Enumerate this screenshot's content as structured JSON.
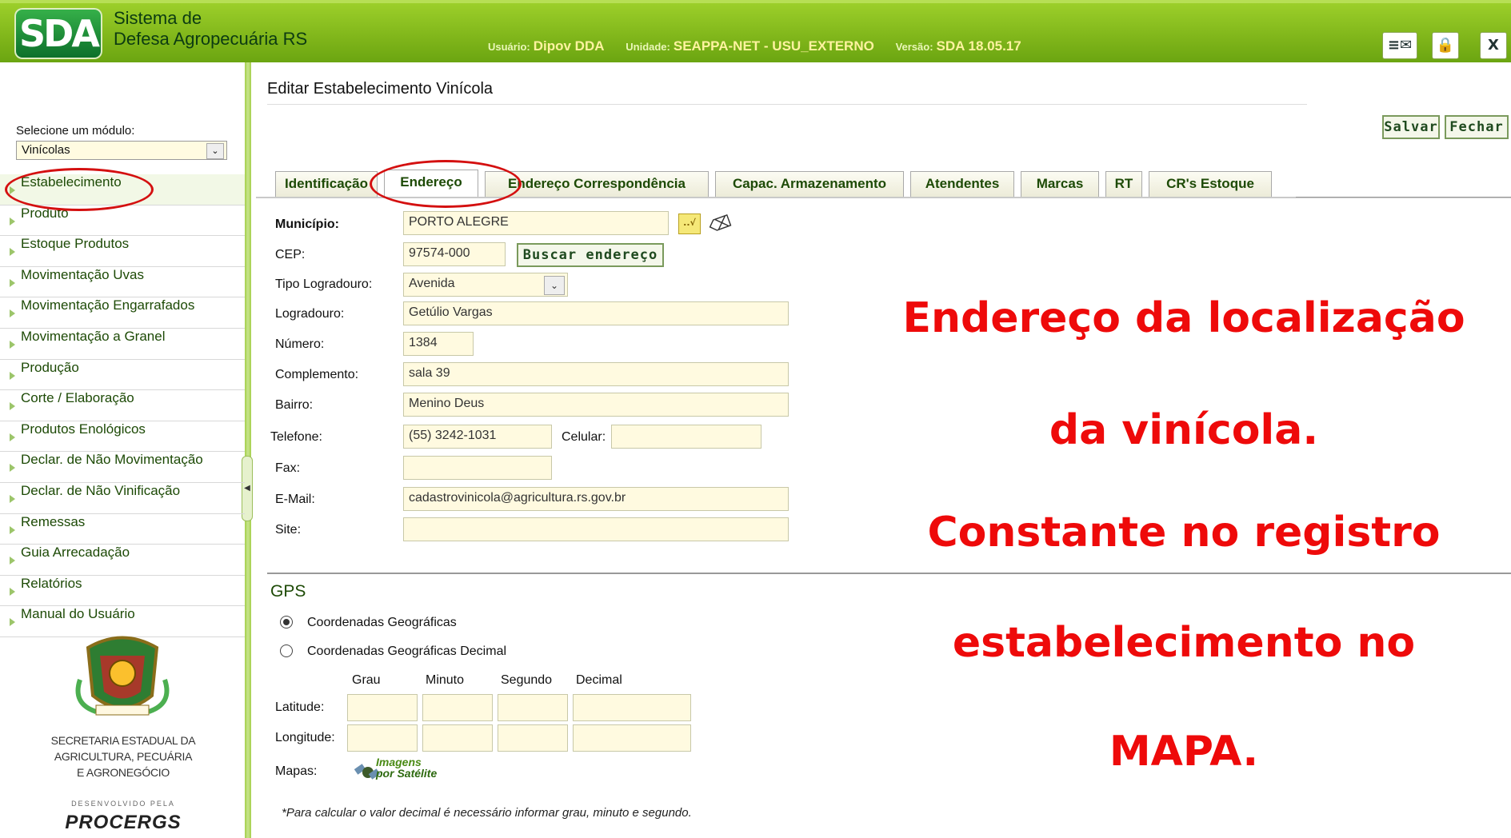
{
  "header": {
    "logo_text": "SDA",
    "app_title_line1": "Sistema de",
    "app_title_line2": "Defesa Agropecuária RS",
    "user_label": "Usuário:",
    "user_value": "Dipov DDA",
    "unit_label": "Unidade:",
    "unit_value": "SEAPPA-NET - USU_EXTERNO",
    "version_label": "Versão:",
    "version_value": "SDA 18.05.17",
    "buttons": [
      "≡✉",
      "🔒",
      "X"
    ]
  },
  "sidebar": {
    "module_label": "Selecione um módulo:",
    "module_value": "Vinícolas",
    "items": [
      {
        "label": "Estabelecimento"
      },
      {
        "label": "Produto"
      },
      {
        "label": "Estoque Produtos"
      },
      {
        "label": "Movimentação Uvas"
      },
      {
        "label": "Movimentação Engarrafados"
      },
      {
        "label": "Movimentação a Granel"
      },
      {
        "label": "Produção"
      },
      {
        "label": "Corte / Elaboração"
      },
      {
        "label": "Produtos Enológicos"
      },
      {
        "label": "Declar. de Não Movimentação"
      },
      {
        "label": "Declar. de Não Vinificação"
      },
      {
        "label": "Remessas"
      },
      {
        "label": "Guia Arrecadação"
      },
      {
        "label": "Relatórios"
      },
      {
        "label": "Manual do Usuário"
      }
    ],
    "secretaria_line1": "SECRETARIA ESTADUAL DA",
    "secretaria_line2": "AGRICULTURA, PECUÁRIA",
    "secretaria_line3": "E AGRONEGÓCIO",
    "developed_by": "DESENVOLVIDO PELA",
    "procergs": "PROCERGS"
  },
  "main": {
    "page_title": "Editar Estabelecimento Vinícola",
    "save_label": "Salvar",
    "close_label": "Fechar",
    "tabs": [
      {
        "label": "Identificação"
      },
      {
        "label": "Endereço"
      },
      {
        "label": "Endereço Correspondência"
      },
      {
        "label": "Capac. Armazenamento"
      },
      {
        "label": "Atendentes"
      },
      {
        "label": "Marcas"
      },
      {
        "label": "RT"
      },
      {
        "label": "CR's Estoque"
      }
    ],
    "form": {
      "municipio_label": "Município:",
      "municipio_value": "PORTO ALEGRE",
      "cep_label": "CEP:",
      "cep_value": "97574-000",
      "buscar_label": "Buscar endereço",
      "tipo_label": "Tipo Logradouro:",
      "tipo_value": "Avenida",
      "logradouro_label": "Logradouro:",
      "logradouro_value": "Getúlio Vargas",
      "numero_label": "Número:",
      "numero_value": "1384",
      "complemento_label": "Complemento:",
      "complemento_value": "sala 39",
      "bairro_label": "Bairro:",
      "bairro_value": "Menino Deus",
      "telefone_label": "Telefone:",
      "telefone_value": "(55) 3242-1031",
      "celular_label": "Celular:",
      "celular_value": "",
      "fax_label": "Fax:",
      "fax_value": "",
      "email_label": "E-Mail:",
      "email_value": "cadastrovinicola@agricultura.rs.gov.br",
      "site_label": "Site:",
      "site_value": ""
    },
    "gps": {
      "title": "GPS",
      "option1": "Coordenadas Geográficas",
      "option2": "Coordenadas Geográficas Decimal",
      "selected": "Coordenadas Geográficas",
      "col_grau": "Grau",
      "col_minuto": "Minuto",
      "col_segundo": "Segundo",
      "col_decimal": "Decimal",
      "latitude_label": "Latitude:",
      "longitude_label": "Longitude:",
      "mapas_label": "Mapas:",
      "sat_line1": "Imagens",
      "sat_line2": "por Satélite",
      "note": "*Para calcular o valor decimal é necessário informar grau, minuto e segundo."
    }
  },
  "annotation": {
    "line1": "Endereço da localização",
    "line2": "da vinícola.",
    "line3": "Constante no registro",
    "line4": "estabelecimento no",
    "line5": "MAPA.",
    "color": "#ee0a0a"
  },
  "colors": {
    "header": "#7fb51a",
    "accent_green": "#1d4a06",
    "field_bg": "#fffae0"
  }
}
